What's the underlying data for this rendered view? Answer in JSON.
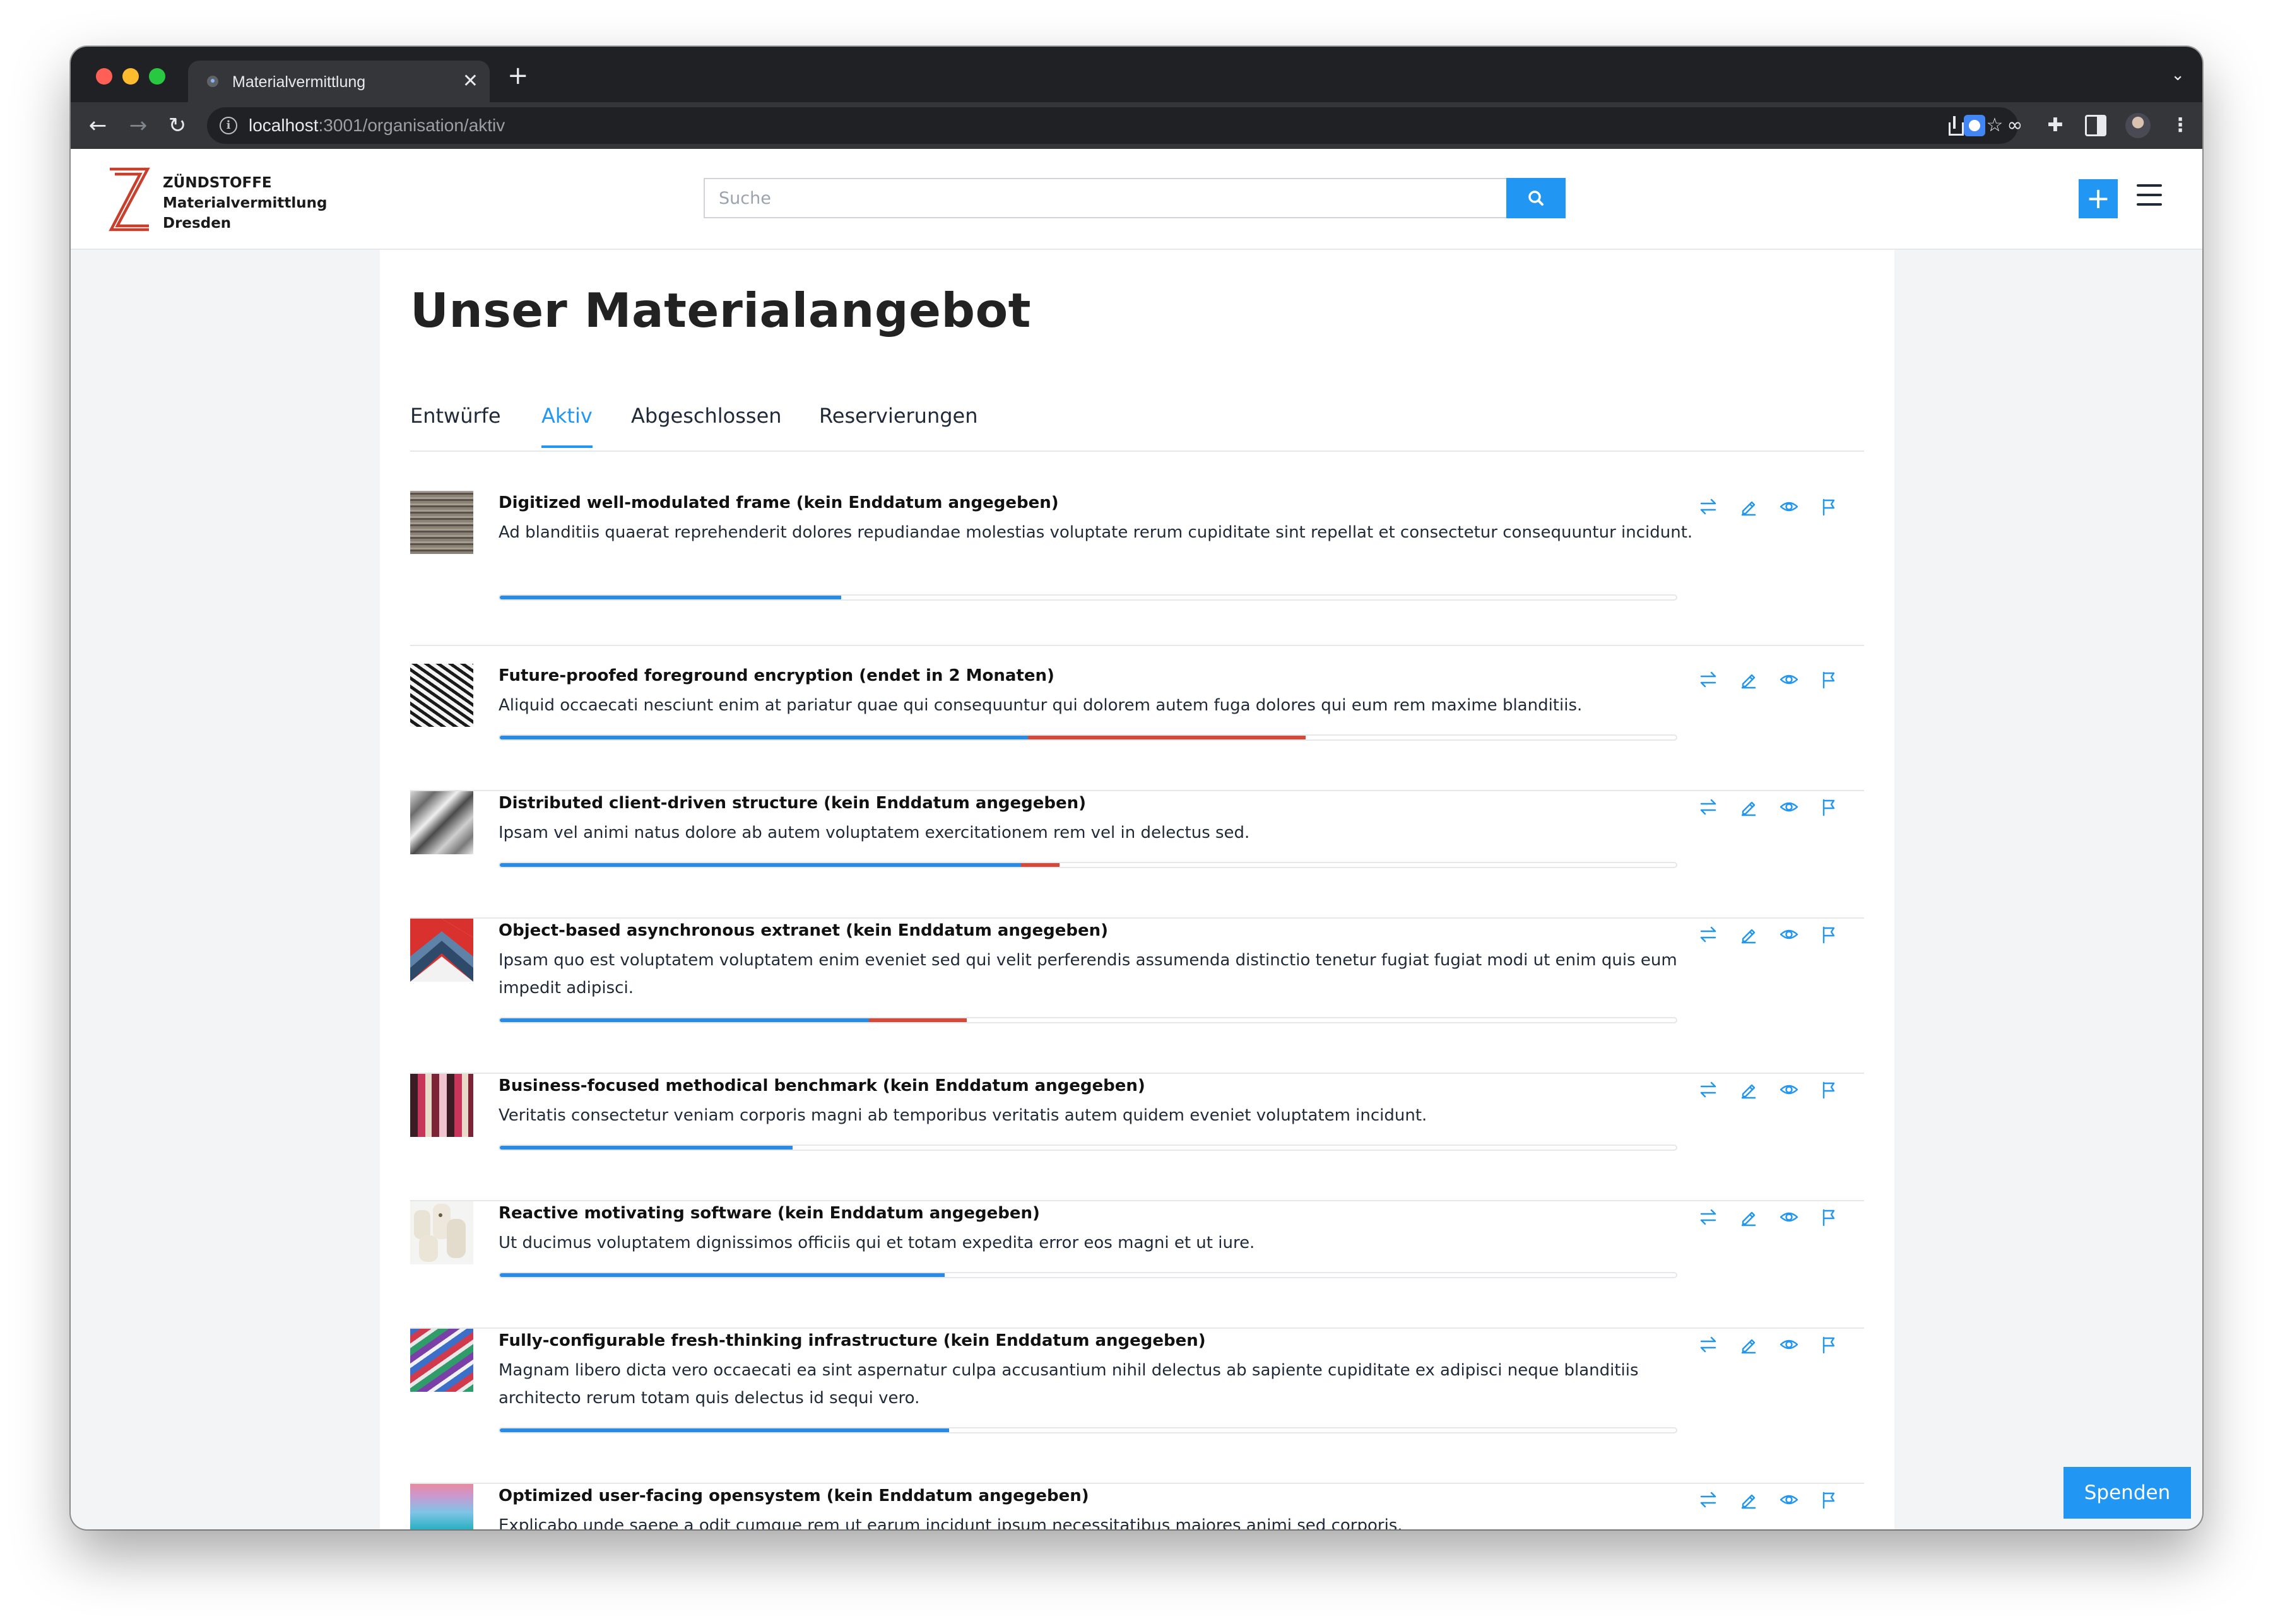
{
  "browser": {
    "tab_title": "Materialvermittlung",
    "tab_close": "✕",
    "new_tab": "+",
    "url_host": "localhost",
    "url_rest": ":3001/organisation/aktiv"
  },
  "header": {
    "brand_line1": "ZÜNDSTOFFE",
    "brand_line2": "Materialvermittlung",
    "brand_line3": "Dresden",
    "search_placeholder": "Suche",
    "add_label": "+"
  },
  "page": {
    "title": "Unser Materialangebot",
    "tabs": [
      {
        "label": "Entwürfe",
        "active": false
      },
      {
        "label": "Aktiv",
        "active": true
      },
      {
        "label": "Abgeschlossen",
        "active": false
      },
      {
        "label": "Reservierungen",
        "active": false
      }
    ]
  },
  "items": [
    {
      "title": "Digitized well-modulated frame (kein Enddatum angegeben)",
      "description": "Ad blanditiis quaerat reprehenderit dolores repudiandae molestias voluptate rerum cupiditate sint repellat et consectetur consequuntur incidunt.",
      "progress_blue": 0.29,
      "progress_red": 0.0
    },
    {
      "title": "Future-proofed foreground encryption (endet in 2 Monaten)",
      "description": "Aliquid occaecati nesciunt enim at pariatur quae qui consequuntur qui dolorem autem fuga dolores qui eum rem maxime blanditiis.",
      "progress_blue": 0.449,
      "progress_red": 0.236
    },
    {
      "title": "Distributed client-driven structure (kein Enddatum angegeben)",
      "description": "Ipsam vel animi natus dolore ab autem voluptatem exercitationem rem vel in delectus sed.",
      "progress_blue": 0.443,
      "progress_red": 0.033
    },
    {
      "title": "Object-based asynchronous extranet (kein Enddatum angegeben)",
      "description": "Ipsam quo est voluptatem voluptatem enim eveniet sed qui velit perferendis assumenda distinctio tenetur fugiat fugiat modi ut enim quis eum impedit adipisci.",
      "progress_blue": 0.314,
      "progress_red": 0.083
    },
    {
      "title": "Business-focused methodical benchmark (kein Enddatum angegeben)",
      "description": "Veritatis consectetur veniam corporis magni ab temporibus veritatis autem quidem eveniet voluptatem incidunt.",
      "progress_blue": 0.249,
      "progress_red": 0.0
    },
    {
      "title": "Reactive motivating software (kein Enddatum angegeben)",
      "description": "Ut ducimus voluptatem dignissimos officiis qui et totam expedita error eos magni et ut iure.",
      "progress_blue": 0.378,
      "progress_red": 0.0
    },
    {
      "title": "Fully-configurable fresh-thinking infrastructure (kein Enddatum angegeben)",
      "description": "Magnam libero dicta vero occaecati ea sint aspernatur culpa accusantium nihil delectus ab sapiente cupiditate ex adipisci neque blanditiis architecto rerum totam quis delectus id sequi vero.",
      "progress_blue": 0.382,
      "progress_red": 0.0
    },
    {
      "title": "Optimized user-facing opensystem (kein Enddatum angegeben)",
      "description": "Explicabo unde saepe a odit cumque rem ut earum incidunt ipsum necessitatibus maiores animi sed corporis.",
      "progress_blue": 0.0,
      "progress_red": 0.0
    }
  ],
  "item_actions": [
    "swap-icon",
    "edit-icon",
    "view-icon",
    "flag-icon"
  ],
  "donate_label": "Spenden",
  "colors": {
    "accent": "#2196f3",
    "progress_blue": "#2b8be3",
    "progress_red": "#d44a3a",
    "logo_red": "#c8402d"
  }
}
